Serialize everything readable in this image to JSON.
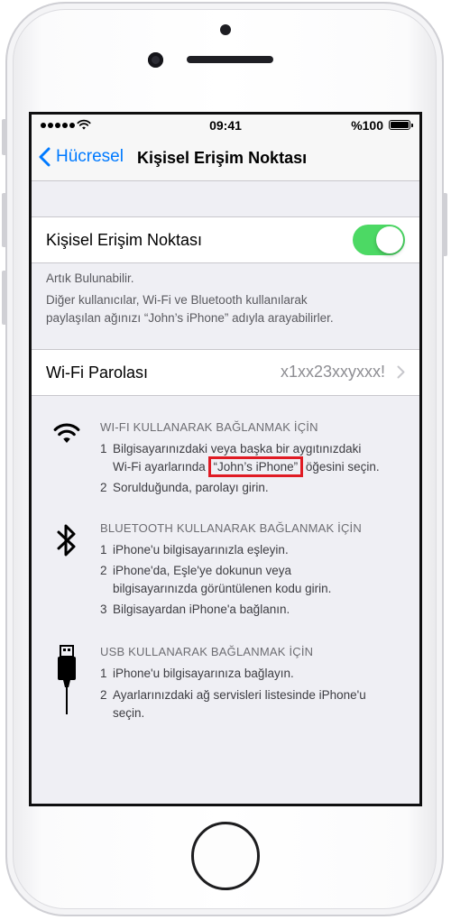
{
  "status_bar": {
    "time": "09:41",
    "battery": "%100"
  },
  "nav": {
    "back_label": "Hücresel",
    "title": "Kişisel Erişim Noktası"
  },
  "hotspot": {
    "label": "Kişisel Erişim Noktası",
    "enabled": true,
    "status": "Artık Bulunabilir.",
    "desc_line1": "Diğer kullanıcılar, Wi-Fi ve Bluetooth kullanılarak",
    "desc_line2": "paylaşılan ağınızı “John’s iPhone” adıyla arayabilirler."
  },
  "wifi_password": {
    "label": "Wi-Fi Parolası",
    "value": "x1xx23xxyxxx!"
  },
  "wifi_section": {
    "icon": "wifi-icon",
    "heading": "WI-FI KULLANARAK BAĞLANMAK İÇİN",
    "step1_num": "1",
    "step1_a": "Bilgisayarınızdaki veya başka bir aygıtınızdaki",
    "step1_b_pre": "Wi-Fi ayarlarında",
    "step1_b_highlight": "“John’s iPhone”",
    "step1_b_post": "öğesini seçin.",
    "step2_num": "2",
    "step2": "Sorulduğunda, parolayı girin."
  },
  "bluetooth_section": {
    "icon": "bluetooth-icon",
    "heading": "BLUETOOTH KULLANARAK BAĞLANMAK İÇİN",
    "step1_num": "1",
    "step1": "iPhone'u bilgisayarınızla eşleyin.",
    "step2_num": "2",
    "step2_a": "iPhone'da, Eşle'ye dokunun veya",
    "step2_b": "bilgisayarınızda görüntülenen kodu girin.",
    "step3_num": "3",
    "step3": "Bilgisayardan iPhone'a bağlanın."
  },
  "usb_section": {
    "icon": "usb-cable-icon",
    "heading": "USB KULLANARAK BAĞLANMAK İÇİN",
    "step1_num": "1",
    "step1": "iPhone'u bilgisayarınıza bağlayın.",
    "step2_num": "2",
    "step2_a": "Ayarlarınızdaki ağ servisleri listesinde iPhone'u",
    "step2_b": "seçin."
  },
  "colors": {
    "accent": "#007aff",
    "toggle_on": "#4cd964",
    "highlight_box": "#e01b24",
    "background": "#efeff4"
  }
}
